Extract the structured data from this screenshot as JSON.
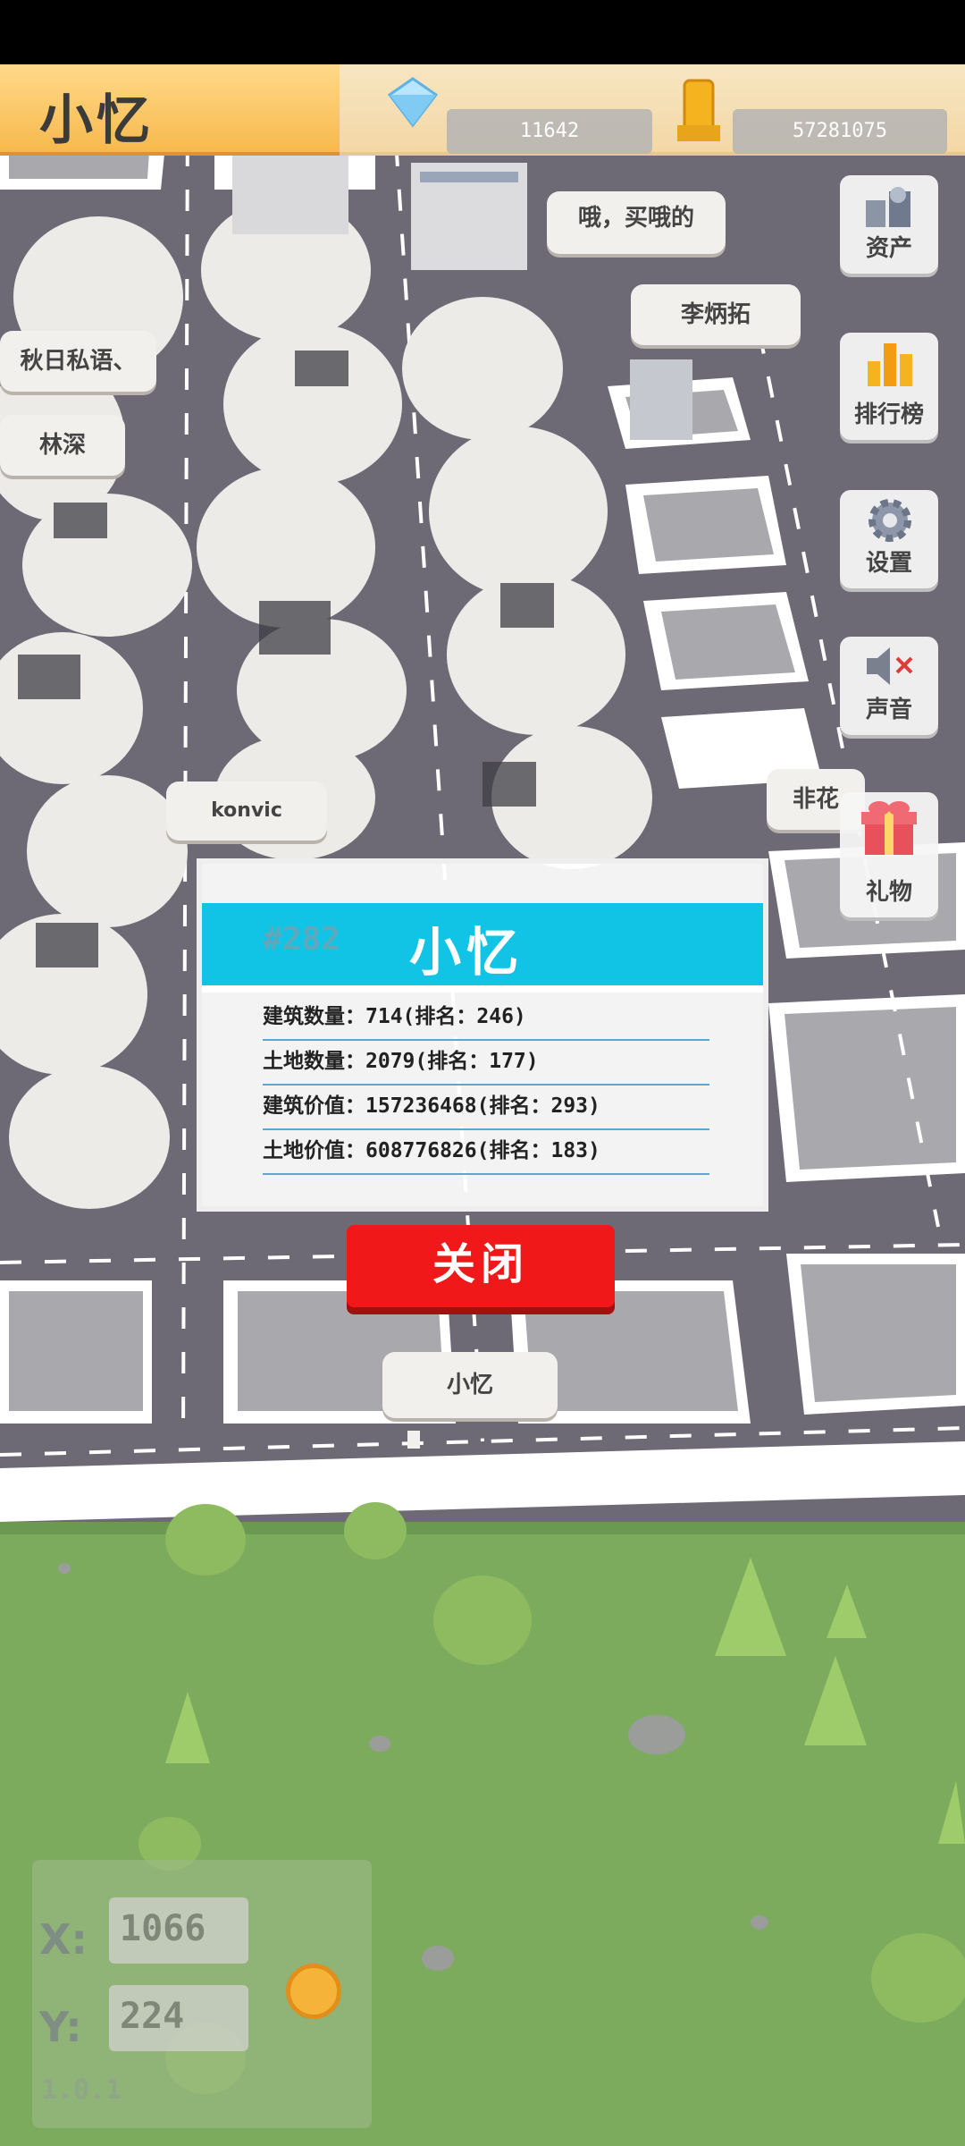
{
  "header": {
    "title": "小忆",
    "diamonds": "11642",
    "coins": "57281075"
  },
  "world_labels": {
    "chat_bubble": "哦，买哦的",
    "player_li": "李炳拓",
    "player_qiuri": "秋日私语、",
    "player_linshen": "林深",
    "player_konvic": "konvic",
    "player_fei": "非花",
    "player_self": "小忆"
  },
  "menu": {
    "assets": "资产",
    "ranking": "排行榜",
    "settings": "设置",
    "sound": "声音",
    "gift": "礼物"
  },
  "dialog": {
    "rank": "#282",
    "name": "小忆",
    "stats": [
      "建筑数量：714(排名：246)",
      "土地数量：2079(排名：177)",
      "建筑价值：157236468(排名：293)",
      "土地价值：608776826(排名：183)"
    ],
    "close_label": "关闭"
  },
  "coords": {
    "x_label": "X:",
    "x_value": "1066",
    "y_label": "Y:",
    "y_value": "224",
    "version": "1.0.1"
  },
  "colors": {
    "header_bg": "#f7b94c",
    "dialog_head": "#11c4e6",
    "close_button": "#f01818",
    "grass": "#7cab5e"
  },
  "icons": {
    "diamond": "diamond-icon",
    "coin": "coin-icon",
    "assets": "coins-stack-icon",
    "ranking": "bar-chart-icon",
    "settings": "gear-icon",
    "sound": "speaker-muted-icon",
    "gift": "gift-icon"
  }
}
